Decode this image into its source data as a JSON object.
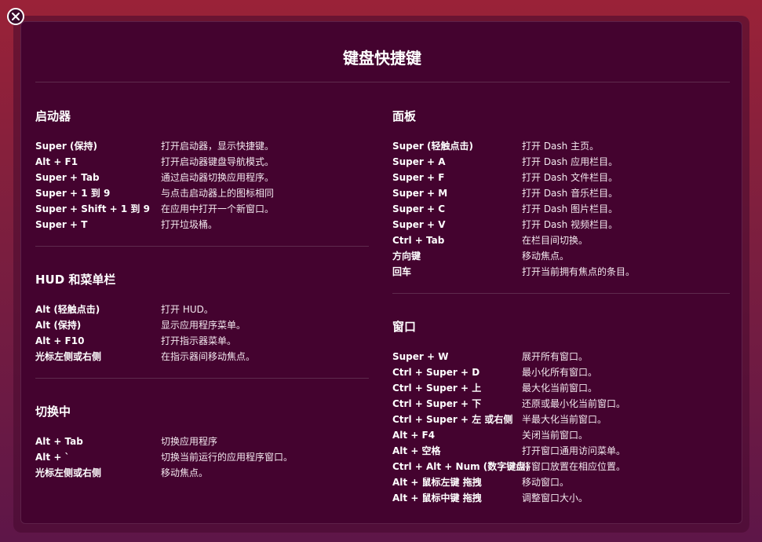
{
  "title": "键盘快捷键",
  "sections": {
    "launcher": {
      "title": "启动器",
      "rows": [
        {
          "key": "Super (保持)",
          "desc": "打开启动器，显示快捷键。"
        },
        {
          "key": "Alt + F1",
          "desc": "打开启动器键盘导航模式。"
        },
        {
          "key": "Super + Tab",
          "desc": "通过启动器切换应用程序。"
        },
        {
          "key": "Super + 1 到 9",
          "desc": "与点击启动器上的图标相同"
        },
        {
          "key": "Super + Shift + 1 到 9",
          "desc": "在应用中打开一个新窗口。"
        },
        {
          "key": "Super + T",
          "desc": "打开垃圾桶。"
        }
      ]
    },
    "hud": {
      "title": "HUD 和菜单栏",
      "rows": [
        {
          "key": "Alt (轻触点击)",
          "desc": "打开 HUD。"
        },
        {
          "key": "Alt (保持)",
          "desc": "显示应用程序菜单。"
        },
        {
          "key": "Alt + F10",
          "desc": "打开指示器菜单。"
        },
        {
          "key": "光标左侧或右侧",
          "desc": "在指示器间移动焦点。"
        }
      ]
    },
    "switching": {
      "title": "切换中",
      "rows": [
        {
          "key": "Alt + Tab",
          "desc": "切换应用程序"
        },
        {
          "key": "Alt + `",
          "desc": "切换当前运行的应用程序窗口。"
        },
        {
          "key": "光标左侧或右侧",
          "desc": "移动焦点。"
        }
      ]
    },
    "dash": {
      "title": "面板",
      "rows": [
        {
          "key": "Super (轻触点击)",
          "desc": "打开 Dash 主页。"
        },
        {
          "key": "Super + A",
          "desc": "打开 Dash 应用栏目。"
        },
        {
          "key": "Super + F",
          "desc": "打开 Dash 文件栏目。"
        },
        {
          "key": "Super + M",
          "desc": "打开 Dash 音乐栏目。"
        },
        {
          "key": "Super + C",
          "desc": "打开 Dash 图片栏目。"
        },
        {
          "key": "Super + V",
          "desc": "打开 Dash 视频栏目。"
        },
        {
          "key": "Ctrl + Tab",
          "desc": "在栏目间切换。"
        },
        {
          "key": "方向键",
          "desc": "移动焦点。"
        },
        {
          "key": "回车",
          "desc": "打开当前拥有焦点的条目。"
        }
      ]
    },
    "windows": {
      "title": "窗口",
      "rows": [
        {
          "key": "Super + W",
          "desc": "展开所有窗口。"
        },
        {
          "key": "Ctrl + Super + D",
          "desc": "最小化所有窗口。"
        },
        {
          "key": "Ctrl + Super + 上",
          "desc": "最大化当前窗口。"
        },
        {
          "key": "Ctrl + Super + 下",
          "desc": "还原或最小化当前窗口。"
        },
        {
          "key": "Ctrl + Super + 左 或右侧",
          "desc": "半最大化当前窗口。"
        },
        {
          "key": "Alt + F4",
          "desc": "关闭当前窗口。"
        },
        {
          "key": "Alt + 空格",
          "desc": "打开窗口通用访问菜单。"
        },
        {
          "key": "Ctrl + Alt + Num (数字键盘)",
          "desc": "将窗口放置在相应位置。"
        },
        {
          "key": "Alt + 鼠标左键 拖拽",
          "desc": "移动窗口。"
        },
        {
          "key": "Alt + 鼠标中键 拖拽",
          "desc": "调整窗口大小。"
        }
      ]
    }
  }
}
